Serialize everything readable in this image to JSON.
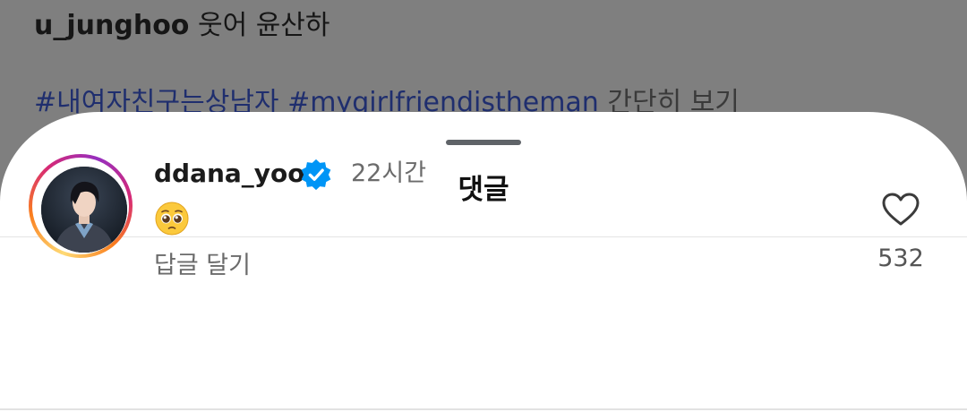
{
  "background_post": {
    "username": "u_junghoo",
    "caption": "웃어 윤산하",
    "hashtags": [
      "#내여자친구는상남자",
      "#mygirlfriendistheman"
    ],
    "more_label": "간단히 보기"
  },
  "sheet": {
    "title": "댓글"
  },
  "comment": {
    "username": "ddana_yoon",
    "verified": true,
    "time": "22시간",
    "emoji": "pleading-face",
    "reply_label": "답글 달기",
    "like_count": "532"
  },
  "colors": {
    "verified_blue": "#0095f6",
    "story_ring": [
      "#feda75",
      "#fa7e1e",
      "#d62976",
      "#962fbf"
    ]
  }
}
